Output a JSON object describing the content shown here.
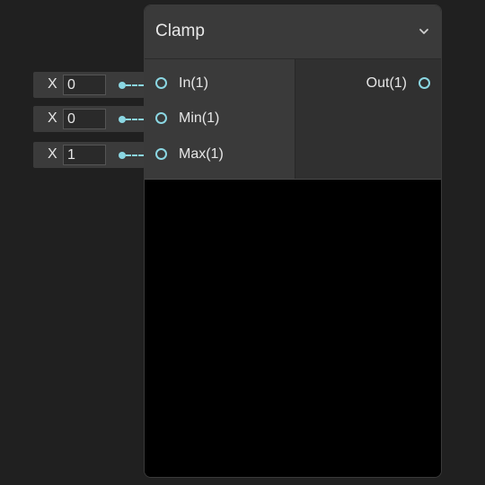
{
  "node": {
    "title": "Clamp",
    "inputs": [
      {
        "label": "In(1)",
        "axis": "X",
        "value": "0"
      },
      {
        "label": "Min(1)",
        "axis": "X",
        "value": "0"
      },
      {
        "label": "Max(1)",
        "axis": "X",
        "value": "1"
      }
    ],
    "outputs": [
      {
        "label": "Out(1)"
      }
    ]
  },
  "icons": {
    "collapse": "chevron-down-icon",
    "port": "port-circle-icon"
  },
  "colors": {
    "port_accent": "#8bd7e3",
    "node_header": "#3a3a3a",
    "canvas_bg": "#202020"
  }
}
